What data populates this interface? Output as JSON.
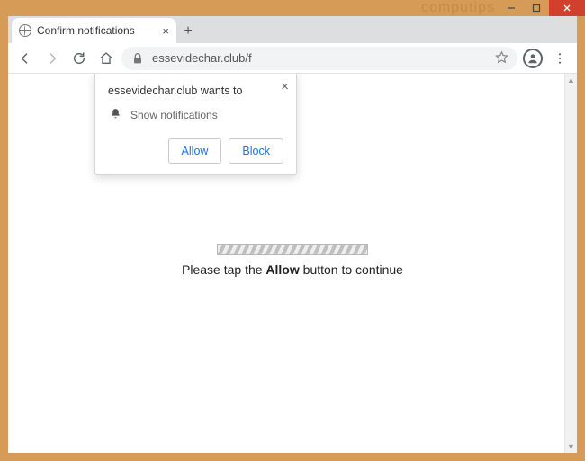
{
  "window": {
    "watermark": "computips"
  },
  "tab": {
    "title": "Confirm notifications"
  },
  "address": {
    "url": "essevidechar.club/f"
  },
  "permission": {
    "heading": "essevidechar.club wants to",
    "item": "Show notifications",
    "allow": "Allow",
    "block": "Block"
  },
  "page": {
    "prompt_pre": "Please tap the ",
    "prompt_bold": "Allow",
    "prompt_post": " button to continue"
  }
}
